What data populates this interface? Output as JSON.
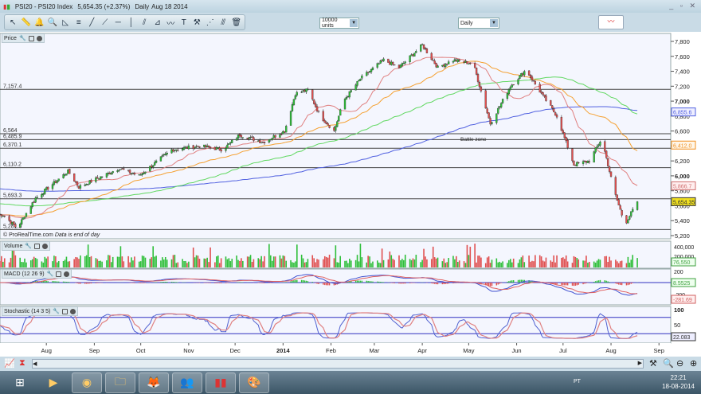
{
  "window": {
    "title": "PSI20 - PSI20 Index",
    "quote": "5,654.35 (+2.37%)",
    "period": "Daily",
    "date": "Aug 18 2014"
  },
  "toolbar": {
    "tools": [
      "pointer-icon",
      "ruler-icon",
      "alarm-bell-icon",
      "zoom-icon",
      "fibonacci-fan-icon",
      "fibonacci-retracement-icon",
      "line-icon",
      "ray-icon",
      "horizontal-line-icon",
      "vertical-line-icon",
      "channel-icon",
      "regression-icon",
      "pattern-icon",
      "text-icon",
      "tools-icon",
      "point-icon",
      "parallel-icon",
      "trash-icon"
    ],
    "units": "10000 units",
    "timeframe": "Daily"
  },
  "panels": {
    "price": "Price",
    "volume": "Volume",
    "macd": "MACD (12 26 9)",
    "stochastic": "Stochastic (14 3 5)"
  },
  "copyright": "© ProRealTime.com",
  "data_note": "Data is end of day",
  "annotation": "Battle zone",
  "levels": [
    {
      "label": "7,157.4",
      "value": 7157.4
    },
    {
      "label": "6,564",
      "value": 6564
    },
    {
      "label": "6,485.9",
      "value": 6485.9
    },
    {
      "label": "6,370.1",
      "value": 6370.1
    },
    {
      "label": "6,110.2",
      "value": 6110.2
    },
    {
      "label": "5,693.3",
      "value": 5693.3
    },
    {
      "label": "5,281.5",
      "value": 5281.5
    }
  ],
  "price_axis": [
    "7,800",
    "7,600",
    "7,400",
    "7,200",
    "7,000",
    "6,800",
    "6,600",
    "6,400",
    "6,200",
    "6,000",
    "5,800",
    "5,600",
    "5,400",
    "5,200"
  ],
  "price_badges": {
    "ma200": "6,855.6",
    "ma50": "6,412.0",
    "ma20": "5,866.7",
    "last": "5,654.35"
  },
  "volume_axis": [
    "400,000",
    "200,000"
  ],
  "volume_badge": "76,550",
  "macd_axis": [
    "200",
    "-200"
  ],
  "macd_badges": {
    "macd": "8.5525",
    "signal": "-281.69"
  },
  "stoch_axis": [
    "100",
    "50"
  ],
  "stoch_badge": "22.083",
  "time_axis": [
    "Aug",
    "Sep",
    "Oct",
    "Nov",
    "Dec",
    "2014",
    "Feb",
    "Mar",
    "Apr",
    "May",
    "Jun",
    "Jul",
    "Aug",
    "Sep"
  ],
  "colors": {
    "up": "#2fbf3a",
    "down": "#e05050",
    "ma20": "#e08080",
    "ma50": "#f5a030",
    "ma100": "#60d860",
    "ma200": "#5060e0",
    "last_badge": "#f0e020"
  },
  "chart_data": {
    "type": "candlestick",
    "price_path": [
      [
        "2013-07-04",
        5480
      ],
      [
        "2013-07-13",
        5300
      ],
      [
        "2013-07-25",
        5700
      ],
      [
        "2013-08-15",
        6060
      ],
      [
        "2013-08-22",
        5850
      ],
      [
        "2013-09-17",
        6100
      ],
      [
        "2013-09-30",
        6000
      ],
      [
        "2013-10-21",
        6350
      ],
      [
        "2013-11-08",
        6400
      ],
      [
        "2013-11-23",
        6350
      ],
      [
        "2013-12-04",
        6550
      ],
      [
        "2013-12-19",
        6450
      ],
      [
        "2014-01-02",
        6600
      ],
      [
        "2014-01-09",
        7100
      ],
      [
        "2014-01-17",
        7150
      ],
      [
        "2014-01-25",
        6800
      ],
      [
        "2014-02-03",
        6600
      ],
      [
        "2014-02-09",
        7000
      ],
      [
        "2014-02-20",
        7300
      ],
      [
        "2014-03-07",
        7550
      ],
      [
        "2014-03-17",
        7450
      ],
      [
        "2014-04-01",
        7750
      ],
      [
        "2014-04-11",
        7450
      ],
      [
        "2014-04-21",
        7550
      ],
      [
        "2014-05-04",
        7500
      ],
      [
        "2014-05-15",
        6700
      ],
      [
        "2014-05-28",
        7200
      ],
      [
        "2014-06-07",
        7420
      ],
      [
        "2014-06-17",
        7100
      ],
      [
        "2014-06-27",
        6800
      ],
      [
        "2014-07-08",
        6150
      ],
      [
        "2014-07-18",
        6200
      ],
      [
        "2014-07-26",
        6500
      ],
      [
        "2014-08-03",
        5800
      ],
      [
        "2014-08-10",
        5350
      ],
      [
        "2014-08-18",
        5654.35
      ]
    ],
    "ylim": [
      5200,
      7800
    ]
  },
  "taskbar": {
    "apps": [
      "windows-start-icon",
      "media-player-icon",
      "chrome-icon",
      "file-explorer-icon",
      "firefox-icon",
      "messenger-icon",
      "prorealtime-icon",
      "paint-icon"
    ],
    "lang": "PT",
    "time": "22:21",
    "date": "18-08-2014"
  }
}
